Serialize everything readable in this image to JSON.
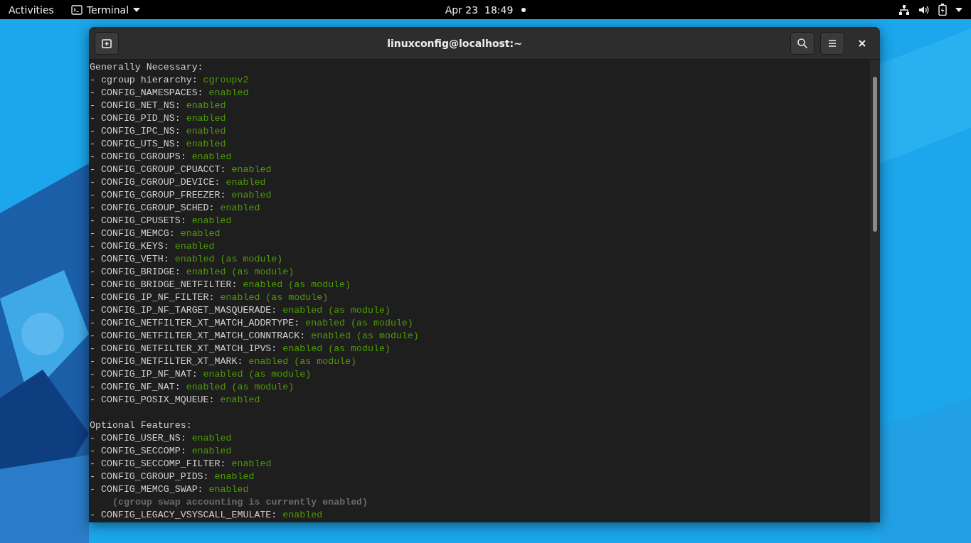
{
  "top_bar": {
    "activities": "Activities",
    "app_menu": "Terminal",
    "clock": "Apr 23  18:49"
  },
  "window": {
    "title": "linuxconfig@localhost:~"
  },
  "terminal": {
    "lines": [
      {
        "kind": "heading",
        "text": "Generally Necessary:"
      },
      {
        "kind": "item",
        "name": "- cgroup hierarchy: ",
        "value": "cgroupv2"
      },
      {
        "kind": "item",
        "name": "- CONFIG_NAMESPACES: ",
        "value": "enabled"
      },
      {
        "kind": "item",
        "name": "- CONFIG_NET_NS: ",
        "value": "enabled"
      },
      {
        "kind": "item",
        "name": "- CONFIG_PID_NS: ",
        "value": "enabled"
      },
      {
        "kind": "item",
        "name": "- CONFIG_IPC_NS: ",
        "value": "enabled"
      },
      {
        "kind": "item",
        "name": "- CONFIG_UTS_NS: ",
        "value": "enabled"
      },
      {
        "kind": "item",
        "name": "- CONFIG_CGROUPS: ",
        "value": "enabled"
      },
      {
        "kind": "item",
        "name": "- CONFIG_CGROUP_CPUACCT: ",
        "value": "enabled"
      },
      {
        "kind": "item",
        "name": "- CONFIG_CGROUP_DEVICE: ",
        "value": "enabled"
      },
      {
        "kind": "item",
        "name": "- CONFIG_CGROUP_FREEZER: ",
        "value": "enabled"
      },
      {
        "kind": "item",
        "name": "- CONFIG_CGROUP_SCHED: ",
        "value": "enabled"
      },
      {
        "kind": "item",
        "name": "- CONFIG_CPUSETS: ",
        "value": "enabled"
      },
      {
        "kind": "item",
        "name": "- CONFIG_MEMCG: ",
        "value": "enabled"
      },
      {
        "kind": "item",
        "name": "- CONFIG_KEYS: ",
        "value": "enabled"
      },
      {
        "kind": "item",
        "name": "- CONFIG_VETH: ",
        "value": "enabled (as module)"
      },
      {
        "kind": "item",
        "name": "- CONFIG_BRIDGE: ",
        "value": "enabled (as module)"
      },
      {
        "kind": "item",
        "name": "- CONFIG_BRIDGE_NETFILTER: ",
        "value": "enabled (as module)"
      },
      {
        "kind": "item",
        "name": "- CONFIG_IP_NF_FILTER: ",
        "value": "enabled (as module)"
      },
      {
        "kind": "item",
        "name": "- CONFIG_IP_NF_TARGET_MASQUERADE: ",
        "value": "enabled (as module)"
      },
      {
        "kind": "item",
        "name": "- CONFIG_NETFILTER_XT_MATCH_ADDRTYPE: ",
        "value": "enabled (as module)"
      },
      {
        "kind": "item",
        "name": "- CONFIG_NETFILTER_XT_MATCH_CONNTRACK: ",
        "value": "enabled (as module)"
      },
      {
        "kind": "item",
        "name": "- CONFIG_NETFILTER_XT_MATCH_IPVS: ",
        "value": "enabled (as module)"
      },
      {
        "kind": "item",
        "name": "- CONFIG_NETFILTER_XT_MARK: ",
        "value": "enabled (as module)"
      },
      {
        "kind": "item",
        "name": "- CONFIG_IP_NF_NAT: ",
        "value": "enabled (as module)"
      },
      {
        "kind": "item",
        "name": "- CONFIG_NF_NAT: ",
        "value": "enabled (as module)"
      },
      {
        "kind": "item",
        "name": "- CONFIG_POSIX_MQUEUE: ",
        "value": "enabled"
      },
      {
        "kind": "blank"
      },
      {
        "kind": "heading",
        "text": "Optional Features:"
      },
      {
        "kind": "item",
        "name": "- CONFIG_USER_NS: ",
        "value": "enabled"
      },
      {
        "kind": "item",
        "name": "- CONFIG_SECCOMP: ",
        "value": "enabled"
      },
      {
        "kind": "item",
        "name": "- CONFIG_SECCOMP_FILTER: ",
        "value": "enabled"
      },
      {
        "kind": "item",
        "name": "- CONFIG_CGROUP_PIDS: ",
        "value": "enabled"
      },
      {
        "kind": "item",
        "name": "- CONFIG_MEMCG_SWAP: ",
        "value": "enabled"
      },
      {
        "kind": "note",
        "text": "(cgroup swap accounting is currently enabled)"
      },
      {
        "kind": "item",
        "name": "- CONFIG_LEGACY_VSYSCALL_EMULATE: ",
        "value": "enabled"
      }
    ]
  }
}
